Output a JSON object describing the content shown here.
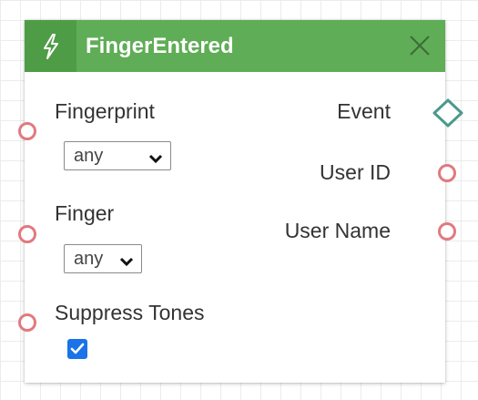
{
  "node": {
    "title": "FingerEntered",
    "header_color": "#5fad56",
    "header_icon": "lightning-icon",
    "close_icon": "close-icon"
  },
  "inputs": [
    {
      "label": "Fingerprint",
      "type": "select",
      "value": "any"
    },
    {
      "label": "Finger",
      "type": "select",
      "value": "any"
    },
    {
      "label": "Suppress Tones",
      "type": "checkbox",
      "checked": true
    }
  ],
  "outputs": [
    {
      "label": "Event",
      "port": "diamond"
    },
    {
      "label": "User ID",
      "port": "circle"
    },
    {
      "label": "User Name",
      "port": "circle"
    }
  ],
  "colors": {
    "port_input": "#e07a7f",
    "port_event": "#4a9a8c",
    "checkbox": "#1a73e8"
  }
}
